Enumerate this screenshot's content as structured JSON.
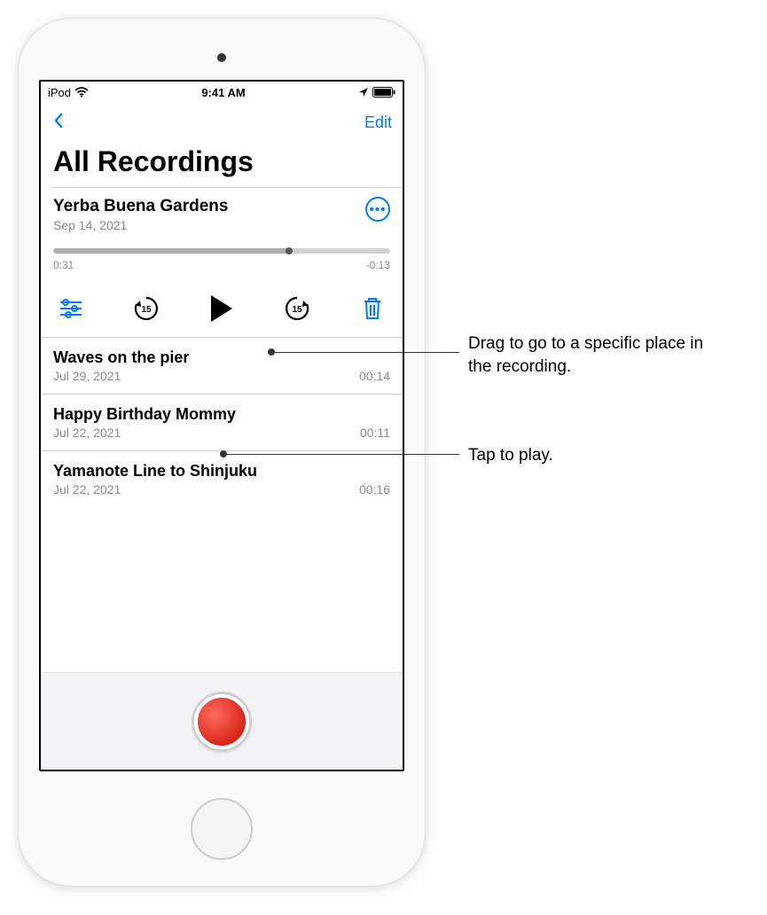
{
  "status": {
    "carrier": "iPod",
    "time": "9:41 AM"
  },
  "nav": {
    "edit": "Edit"
  },
  "title": "All Recordings",
  "expanded": {
    "title": "Yerba Buena Gardens",
    "date": "Sep 14, 2021",
    "elapsed": "0:31",
    "remaining": "-0:13",
    "progress_pct": 70
  },
  "recordings": [
    {
      "title": "Waves on the pier",
      "date": "Jul 29, 2021",
      "duration": "00:14"
    },
    {
      "title": "Happy Birthday Mommy",
      "date": "Jul 22, 2021",
      "duration": "00:11"
    },
    {
      "title": "Yamanote Line to Shinjuku",
      "date": "Jul 22, 2021",
      "duration": "00:16"
    }
  ],
  "callouts": {
    "scrubber": "Drag to go to a specific place in the recording.",
    "play": "Tap to play."
  }
}
